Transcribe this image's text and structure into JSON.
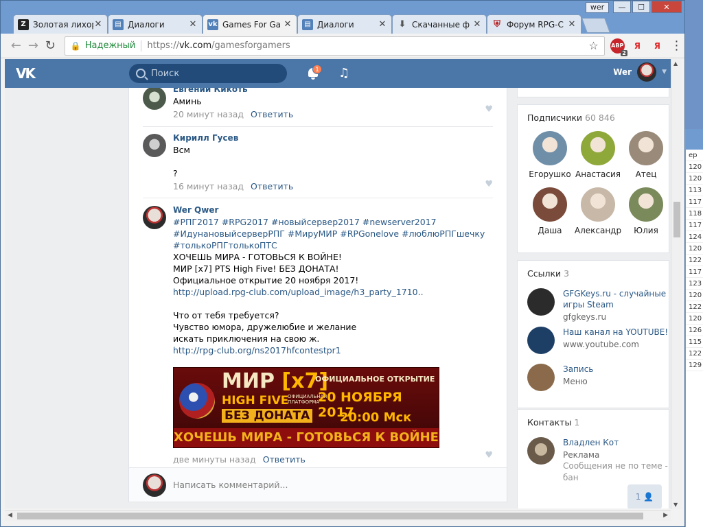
{
  "browser": {
    "user_badge": "wer",
    "tabs": [
      {
        "label": "Золотая лихор",
        "icon": "Z",
        "color": "#222222"
      },
      {
        "label": "Диалоги",
        "icon": "dialog",
        "color": "#5181b8"
      },
      {
        "label": "Games For Ga",
        "icon": "VK",
        "color": "#5181b8",
        "active": true
      },
      {
        "label": "Диалоги",
        "icon": "dialog",
        "color": "#5181b8"
      },
      {
        "label": "Скачанные ф",
        "icon": "download",
        "color": "#555555"
      },
      {
        "label": "Форум RPG-C",
        "icon": "shield",
        "color": "#b32020"
      }
    ],
    "close_glyph": "✕",
    "address": {
      "secure_label": "Надежный",
      "scheme": "https://",
      "host": "vk.com",
      "path": "/gamesforgamers"
    },
    "extensions": {
      "abp": "ABP",
      "abp_count": "2",
      "ya1": "Я",
      "ya2": "Я"
    }
  },
  "vk": {
    "logo": "VK",
    "search_placeholder": "Поиск",
    "notifications_count": "1",
    "user_name": "Wer"
  },
  "comments": [
    {
      "author": "Евгений Кикоть",
      "text": [
        "Аминь"
      ],
      "time": "20 минут назад",
      "reply": "Ответить"
    },
    {
      "author": "Кирилл Гусев",
      "text": [
        "Всм",
        "",
        "?"
      ],
      "time": "16 минут назад",
      "reply": "Ответить"
    },
    {
      "author": "Wer Qwer",
      "tags_line1": "#РПГ2017 #RPG2017 #новыйсервер2017 #newserver2017",
      "tags_line2": "#ИдунановыйсерверРПГ #МируМИР #RPGonelove #люблюРПГшечку",
      "tags_line3": "#толькоРПГтолькоПТС",
      "line1": "ХОЧЕШЬ МИРА - ГОТОВЬСЯ К ВОЙНЕ!",
      "line2": "МИР [x7] PTS High Five! БЕЗ ДОНАТА!",
      "line3": "Официальное открытие 20 ноября 2017!",
      "link1": "http://upload.rpg-club.com/upload_image/h3_party_1710..",
      "line4": "Что от тебя требуется?",
      "line5": "Чувство юмора, дружелюбие и желание",
      "line6": "искать приключения на свою ж.",
      "link2": "http://rpg-club.org/ns2017hfcontestpr1",
      "time": "две минуты назад",
      "reply": "Ответить",
      "banner": {
        "title_a": "МИР",
        "title_b": "[x7]",
        "subtitle": "HIGH FIVE",
        "platform": "ОФИЦИАЛЬНАЯ ПЛАТФОРМА",
        "no_donate": "БЕЗ ДОНАТА",
        "opening": "ОФИЦИАЛЬНОЕ ОТКРЫТИЕ",
        "date": "20 НОЯБРЯ 2017",
        "time": "20:00 Мск",
        "slogan": "ХОЧЕШЬ МИРА - ГОТОВЬСЯ К ВОЙНЕ"
      }
    }
  ],
  "composer": {
    "placeholder": "Написать комментарий..."
  },
  "subscribers": {
    "title": "Подписчики",
    "count": "60 846",
    "people": [
      {
        "name": "Егорушко",
        "color": "#6f8fa8"
      },
      {
        "name": "Анастасия",
        "color": "#8fa83a"
      },
      {
        "name": "Атец",
        "color": "#9a8a7a"
      },
      {
        "name": "Даша",
        "color": "#7a4a3a"
      },
      {
        "name": "Александр",
        "color": "#c7b8a8"
      },
      {
        "name": "Юлия",
        "color": "#7a8a5a"
      }
    ]
  },
  "links": {
    "title": "Ссылки",
    "count": "3",
    "items": [
      {
        "title": "GFGKeys.ru - случайные игры Steam",
        "sub": "gfgkeys.ru",
        "color": "#2b2b2b"
      },
      {
        "title": "Наш канал на YOUTUBE!",
        "sub": "www.youtube.com",
        "color": "#1d3f66"
      },
      {
        "title": "Запись",
        "sub": "Меню",
        "color": "#8a6a4a"
      }
    ]
  },
  "contacts": {
    "title": "Контакты",
    "count": "1",
    "name": "Владлен Кот",
    "role": "Реклама",
    "note": "Сообщения не по теме - бан"
  },
  "chat": {
    "count": "1"
  },
  "background_window": {
    "numbers": [
      "ер",
      "120",
      "120",
      "113",
      "117",
      "118",
      "117",
      "124",
      "120",
      "122",
      "117",
      "123",
      "120",
      "122",
      "120",
      "126",
      "115",
      "122",
      "129"
    ]
  }
}
